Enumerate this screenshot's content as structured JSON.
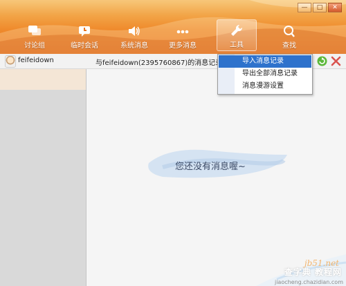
{
  "window": {
    "controls": {
      "minimize": "—",
      "maximize": "□",
      "close": "✕"
    }
  },
  "toolbar": {
    "items": [
      {
        "label": "讨论组",
        "icon": "group-chat-icon"
      },
      {
        "label": "临时会话",
        "icon": "temp-chat-icon"
      },
      {
        "label": "系统消息",
        "icon": "speaker-icon"
      },
      {
        "label": "更多消息",
        "icon": "more-dots-icon"
      },
      {
        "label": "工具",
        "icon": "wrench-icon",
        "active": true
      },
      {
        "label": "查找",
        "icon": "search-icon"
      }
    ]
  },
  "contact": {
    "name": "feifeidown"
  },
  "history": {
    "title": "与feifeidown(2395760867)的消息记录"
  },
  "menu": {
    "items": [
      {
        "label": "导入消息记录",
        "selected": true
      },
      {
        "label": "导出全部消息记录",
        "selected": false
      },
      {
        "label": "消息漫游设置",
        "selected": false
      }
    ]
  },
  "empty_state": {
    "text": "您还没有消息喔~"
  },
  "watermark": {
    "site": "jb51.net",
    "brand": "查字典 教程网",
    "domain": "jiaocheng.chazidian.com"
  },
  "colors": {
    "accent": "#ef8a2c",
    "menu_highlight": "#2e72cc"
  }
}
